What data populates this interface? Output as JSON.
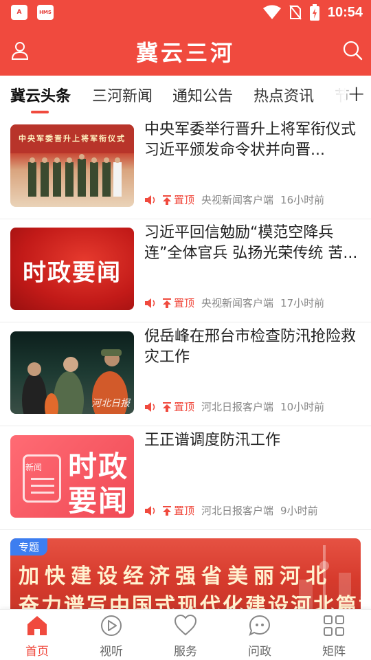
{
  "status_bar": {
    "time": "10:54",
    "badges": [
      "A",
      "HMS"
    ]
  },
  "header": {
    "title": "冀云三河",
    "user_icon": "user-icon",
    "search_icon": "search-icon"
  },
  "tabs": [
    {
      "label": "冀云头条",
      "active": true
    },
    {
      "label": "三河新闻",
      "active": false
    },
    {
      "label": "通知公告",
      "active": false
    },
    {
      "label": "热点资讯",
      "active": false
    },
    {
      "label": "节",
      "active": false
    }
  ],
  "news": [
    {
      "title": "中央军委举行晋升上将军衔仪式 习近平颁发命令状并向晋...",
      "pin": "置顶",
      "source": "央视新闻客户端",
      "time": "16小时前",
      "thumb_caption": "中央军委晋升上将军衔仪式"
    },
    {
      "title": "习近平回信勉励“模范空降兵连”全体官兵 弘扬光荣传统 苦...",
      "pin": "置顶",
      "source": "央视新闻客户端",
      "time": "17小时前",
      "thumb_caption": "时政要闻"
    },
    {
      "title": "倪岳峰在邢台市检查防汛抢险救灾工作",
      "pin": "置顶",
      "source": "河北日报客户端",
      "time": "10小时前",
      "thumb_caption": "河北日报"
    },
    {
      "title": "王正谱调度防汛工作",
      "pin": "置顶",
      "source": "河北日报客户端",
      "time": "9小时前",
      "thumb_caption_a": "时政",
      "thumb_caption_b": "要闻",
      "thumb_caption_c": "新闻"
    }
  ],
  "banner": {
    "tag": "专题",
    "line1": "加快建设经济强省美丽河北",
    "line2": "奋力谱写中国式现代化建设河北篇章"
  },
  "bottom_nav": [
    {
      "label": "首页",
      "icon": "home-icon",
      "active": true
    },
    {
      "label": "视听",
      "icon": "play-icon",
      "active": false
    },
    {
      "label": "服务",
      "icon": "heart-icon",
      "active": false
    },
    {
      "label": "问政",
      "icon": "chat-icon",
      "active": false
    },
    {
      "label": "矩阵",
      "icon": "grid-icon",
      "active": false
    }
  ],
  "colors": {
    "brand": "#f04a3e",
    "text": "#222222",
    "meta": "#888888",
    "tag": "#3d7ef0"
  }
}
